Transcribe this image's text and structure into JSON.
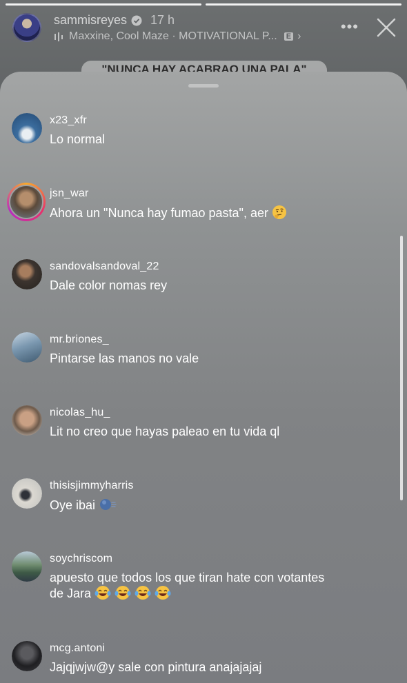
{
  "story": {
    "username": "sammisreyes",
    "time": "17 h",
    "music": "Maxxine, Cool Maze · MOTIVATIONAL P...",
    "explicit_badge": "E",
    "sticker_text": "\"NUNCA HAY ACABRAO UNA PALA\"",
    "progress": [
      1.0,
      1.0
    ]
  },
  "comments": [
    {
      "username": "x23_xfr",
      "text": "Lo normal",
      "avatar_color": "#3d6a9c"
    },
    {
      "username": "jsn_war",
      "text": "Ahora un \"Nunca hay fumao pasta\", aer",
      "emoji": "thinking-face",
      "avatar_color": "#6c5a48",
      "story_ring": true
    },
    {
      "username": "sandovalsandoval_22",
      "text": "Dale color nomas rey",
      "avatar_color": "#4a3d34"
    },
    {
      "username": "mr.briones_",
      "text": "Pintarse las manos no vale",
      "avatar_color": "#7f98ad"
    },
    {
      "username": "nicolas_hu_",
      "text": "Lit no creo que hayas paleao en tu vida ql",
      "avatar_color": "#9d7b63"
    },
    {
      "username": "thisisjimmyharris",
      "text": "Oye ibai",
      "emoji": "blue-dashing-icon",
      "avatar_color": "#d9d6cf"
    },
    {
      "username": "soychriscom",
      "text": "apuesto que todos los que tiran hate con votantes de Jara",
      "emoji": "laughing-tears x4",
      "avatar_color": "#5d7c67"
    },
    {
      "username": "mcg.antoni",
      "text": "Jajqjwjw@y sale con pintura anajajajaj",
      "avatar_color": "#2d2d2f"
    }
  ],
  "colors": {
    "text": "#ffffff",
    "sheet_top": "#a3a5a5",
    "sheet_bottom": "#7a7c80"
  }
}
